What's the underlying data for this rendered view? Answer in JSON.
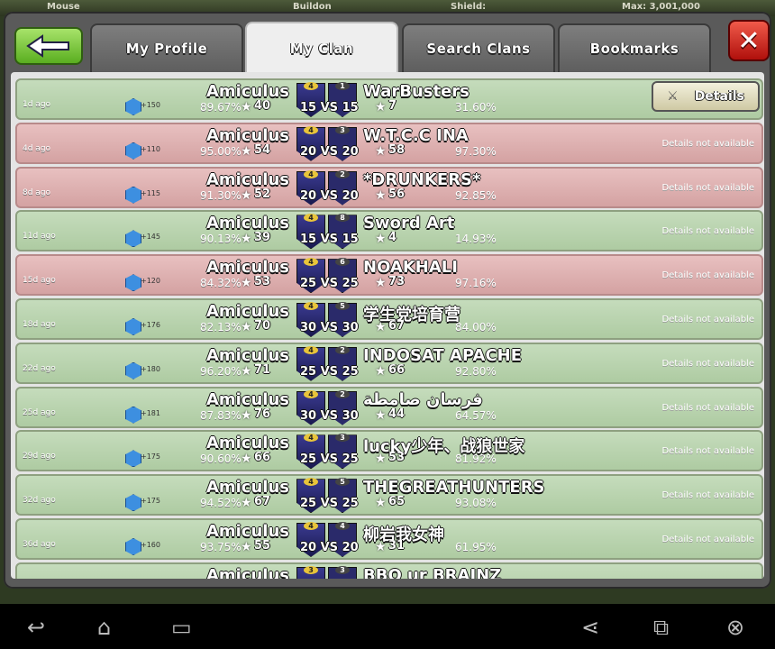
{
  "hud": {
    "left_label": "Mouse",
    "mid_label": "Buildon",
    "mid2_label": "Shield:",
    "right_label": "Max: 3,001,000"
  },
  "tabs": [
    {
      "label": "My Profile",
      "active": false
    },
    {
      "label": "My Clan",
      "active": true
    },
    {
      "label": "Search Clans",
      "active": false
    },
    {
      "label": "Bookmarks",
      "active": false
    }
  ],
  "icons": {
    "back": "back-arrow-icon",
    "close": "close-x-icon"
  },
  "colors": {
    "win_row": "#b8d4ae",
    "loss_row": "#dcb0b0",
    "close_red": "#d0241a",
    "back_green": "#7cc83e"
  },
  "details_label": "Details",
  "details_not_available": "Details not available",
  "wars": [
    {
      "ago": "1d ago",
      "xp": "+150",
      "our_name": "Amiculus",
      "our_pct": "89.67%",
      "our_stars": "40",
      "our_level": "4",
      "size": "15 VS 15",
      "opp_name": "WarBusters",
      "opp_level": "1",
      "opp_stars": "7",
      "opp_pct": "31.60%",
      "result": "win",
      "details": true
    },
    {
      "ago": "4d ago",
      "xp": "+110",
      "our_name": "Amiculus",
      "our_pct": "95.00%",
      "our_stars": "54",
      "our_level": "4",
      "size": "20 VS 20",
      "opp_name": "W.T.C.C INA",
      "opp_level": "3",
      "opp_stars": "58",
      "opp_pct": "97.30%",
      "result": "loss",
      "details": false
    },
    {
      "ago": "8d ago",
      "xp": "+115",
      "our_name": "Amiculus",
      "our_pct": "91.30%",
      "our_stars": "52",
      "our_level": "4",
      "size": "20 VS 20",
      "opp_name": "*DRUNKERS*",
      "opp_level": "2",
      "opp_stars": "56",
      "opp_pct": "92.85%",
      "result": "loss",
      "details": false
    },
    {
      "ago": "11d ago",
      "xp": "+145",
      "our_name": "Amiculus",
      "our_pct": "90.13%",
      "our_stars": "39",
      "our_level": "4",
      "size": "15 VS 15",
      "opp_name": "Sword Art",
      "opp_level": "8",
      "opp_stars": "4",
      "opp_pct": "14.93%",
      "result": "win",
      "details": false
    },
    {
      "ago": "15d ago",
      "xp": "+120",
      "our_name": "Amiculus",
      "our_pct": "84.32%",
      "our_stars": "53",
      "our_level": "4",
      "size": "25 VS 25",
      "opp_name": "NOAKHALI",
      "opp_level": "6",
      "opp_stars": "73",
      "opp_pct": "97.16%",
      "result": "loss",
      "details": false
    },
    {
      "ago": "18d ago",
      "xp": "+176",
      "our_name": "Amiculus",
      "our_pct": "82.13%",
      "our_stars": "70",
      "our_level": "4",
      "size": "30 VS 30",
      "opp_name": "学生党培育营",
      "opp_level": "5",
      "opp_stars": "67",
      "opp_pct": "84.00%",
      "result": "win",
      "details": false
    },
    {
      "ago": "22d ago",
      "xp": "+180",
      "our_name": "Amiculus",
      "our_pct": "96.20%",
      "our_stars": "71",
      "our_level": "4",
      "size": "25 VS 25",
      "opp_name": "INDOSAT APACHE",
      "opp_level": "2",
      "opp_stars": "66",
      "opp_pct": "92.80%",
      "result": "win",
      "details": false
    },
    {
      "ago": "25d ago",
      "xp": "+181",
      "our_name": "Amiculus",
      "our_pct": "87.83%",
      "our_stars": "76",
      "our_level": "4",
      "size": "30 VS 30",
      "opp_name": "فرسان صامطة",
      "opp_level": "2",
      "opp_stars": "44",
      "opp_pct": "64.57%",
      "result": "win",
      "details": false
    },
    {
      "ago": "29d ago",
      "xp": "+175",
      "our_name": "Amiculus",
      "our_pct": "90.60%",
      "our_stars": "66",
      "our_level": "4",
      "size": "25 VS 25",
      "opp_name": "lucky少年、战狼世家",
      "opp_level": "3",
      "opp_stars": "53",
      "opp_pct": "81.92%",
      "result": "win",
      "details": false
    },
    {
      "ago": "32d ago",
      "xp": "+175",
      "our_name": "Amiculus",
      "our_pct": "94.52%",
      "our_stars": "67",
      "our_level": "4",
      "size": "25 VS 25",
      "opp_name": "THEGREATHUNTERS",
      "opp_level": "5",
      "opp_stars": "65",
      "opp_pct": "93.08%",
      "result": "win",
      "details": false
    },
    {
      "ago": "36d ago",
      "xp": "+160",
      "our_name": "Amiculus",
      "our_pct": "93.75%",
      "our_stars": "55",
      "our_level": "4",
      "size": "20 VS 20",
      "opp_name": "柳岩我女神",
      "opp_level": "4",
      "opp_stars": "31",
      "opp_pct": "61.95%",
      "result": "win",
      "details": false
    },
    {
      "ago": "",
      "xp": "",
      "our_name": "Amiculus",
      "our_pct": "",
      "our_stars": "",
      "our_level": "3",
      "size": "",
      "opp_name": "BBQ ur BRAINZ",
      "opp_level": "3",
      "opp_stars": "",
      "opp_pct": "",
      "result": "win",
      "details": false
    }
  ],
  "navbar": {
    "icons": [
      "back-nav-icon",
      "home-nav-icon",
      "recents-nav-icon",
      "share-icon",
      "screen-icon",
      "close-circle-icon"
    ]
  }
}
